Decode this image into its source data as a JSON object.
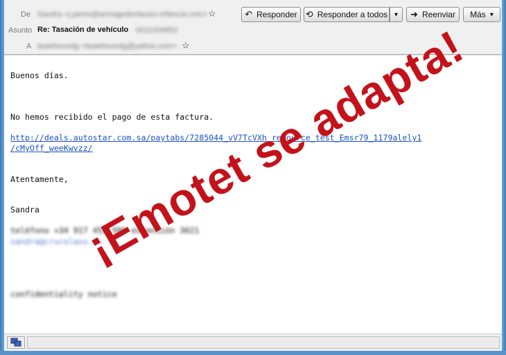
{
  "header": {
    "from_label": "De",
    "from_value": "Sandra <j.peres@armagedonlacion-infancia.com>",
    "subject_label": "Asunto",
    "subject_value": "Re: Tasación de vehículo",
    "subject_suffix": "0011009852",
    "to_label": "A",
    "to_value": "tewehoundg <tewehoundg@yahoo.com>"
  },
  "toolbar": {
    "reply_label": "Responder",
    "reply_all_label": "Responder a todos",
    "forward_label": "Reenviar",
    "more_label": "Más"
  },
  "message": {
    "greeting": "Buenos días.",
    "line1": "No hemos recibido el pago de esta factura.",
    "link_line1": "http://deals.autostar.com.sa/paytabs/7285044_vV7TcVXh_resource_test_Emsr79_1179alely1",
    "link_line2": "/cMyOff_weeKwvzz/",
    "closing": "Atentamente,",
    "signature": "Sandra",
    "sig_blur1": "teléfono +34 917 452 586 extensión 3021",
    "sig_blur2": "sandra@crucolaso.es",
    "sig_blur3": "confidentiality notice"
  },
  "watermark": {
    "text": "¡Emotet se adapta!",
    "color": "#c4121a"
  }
}
